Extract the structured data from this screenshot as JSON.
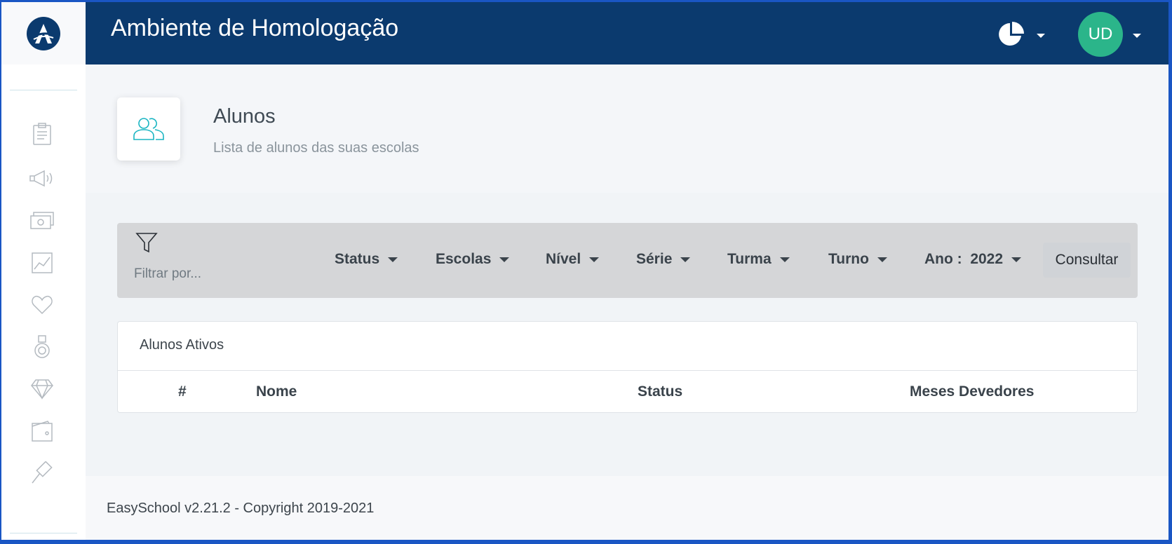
{
  "header": {
    "title": "Ambiente de Homologação",
    "avatar_initials": "UD"
  },
  "sidebar": {
    "icons": [
      "clipboard-icon",
      "megaphone-icon",
      "money-icon",
      "chart-icon",
      "heart-icon",
      "medal-icon",
      "diamond-icon",
      "wallet-icon",
      "gavel-icon"
    ]
  },
  "page": {
    "title": "Alunos",
    "subtitle": "Lista de alunos das suas escolas"
  },
  "filters": {
    "placeholder": "Filtrar por...",
    "status": "Status",
    "escolas": "Escolas",
    "nivel": "Nível",
    "serie": "Série",
    "turma": "Turma",
    "turno": "Turno",
    "ano": "Ano :  2022",
    "button": "Consultar"
  },
  "table": {
    "title": "Alunos Ativos",
    "columns": [
      "#",
      "Nome",
      "Status",
      "Meses Devedores"
    ]
  },
  "footer": {
    "text": "EasySchool v2.21.2 - Copyright 2019-2021"
  },
  "colors": {
    "header_bg": "#0b3a6e",
    "avatar_bg": "#2bb58a",
    "accent_teal": "#1ab5c2"
  }
}
